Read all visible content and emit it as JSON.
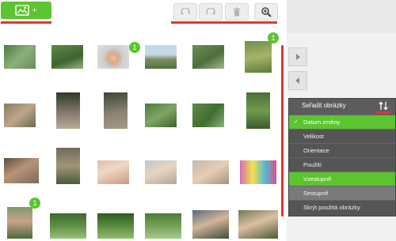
{
  "toolbar": {
    "add_button_label": "+",
    "undo_icon": "undo-icon",
    "redo_icon": "redo-icon",
    "delete_icon": "trash-icon",
    "zoom_icon": "zoom-in-icon"
  },
  "badges": [
    "1",
    "1",
    "1"
  ],
  "sort_menu": {
    "title": "Seřadit obrázky",
    "items": [
      "Datum změny",
      "Velikost",
      "Orientace",
      "Použití",
      "Vzestupně",
      "Sestupně",
      "Skrýt použitá obrázky"
    ],
    "selected_indices": [
      0,
      4
    ]
  },
  "colors": {
    "accent_green": "#5cc42f",
    "highlight_red": "#e2362a",
    "menu_dark": "#555555"
  }
}
